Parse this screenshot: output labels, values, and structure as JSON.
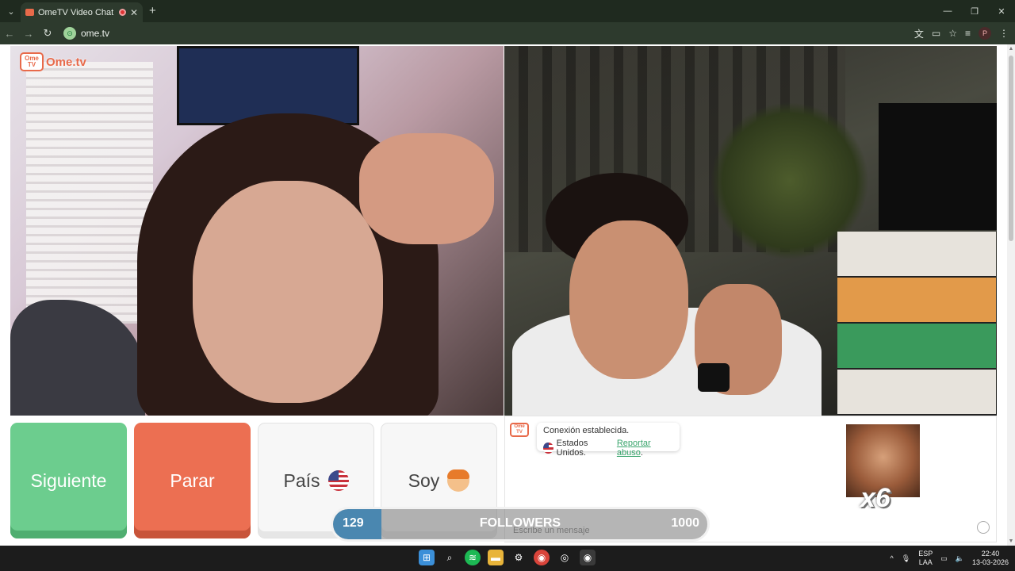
{
  "browser": {
    "tab_title": "OmeTV Video Chat — Omeg",
    "tab_close": "✕",
    "new_tab": "+",
    "tab_menu": "⌄",
    "url": "ome.tv",
    "window_controls": {
      "minimize": "—",
      "maximize": "❐",
      "close": "✕"
    },
    "nav": {
      "back": "←",
      "forward": "→",
      "reload": "↻"
    },
    "profile_initial": "P"
  },
  "logo": {
    "badge": "Ome TV",
    "text": "Ome.tv"
  },
  "controls": {
    "next_label": "Siguiente",
    "stop_label": "Parar",
    "country_label": "País",
    "soy_label": "Soy"
  },
  "chat": {
    "icon_text": "Ome TV",
    "connected_text": "Conexión establecida.",
    "country_text": "Estados Unidos.",
    "report_link": "Reportar abuso",
    "report_suffix": ".",
    "input_placeholder": "Escribe un mensaje",
    "meme_multiplier": "x6"
  },
  "followers_overlay": {
    "current": "129",
    "label": "FOLLOWERS",
    "goal": "1000",
    "progress_fraction": 0.129
  },
  "taskbar": {
    "language_top": "ESP",
    "language_bottom": "LAA",
    "time": "22:40",
    "date": "13-03-2026"
  },
  "colors": {
    "next": "#6ccd8e",
    "stop": "#ec6f52",
    "brand": "#e86a4a",
    "link": "#3aa56d",
    "followers_fill": "#4a87b0"
  }
}
